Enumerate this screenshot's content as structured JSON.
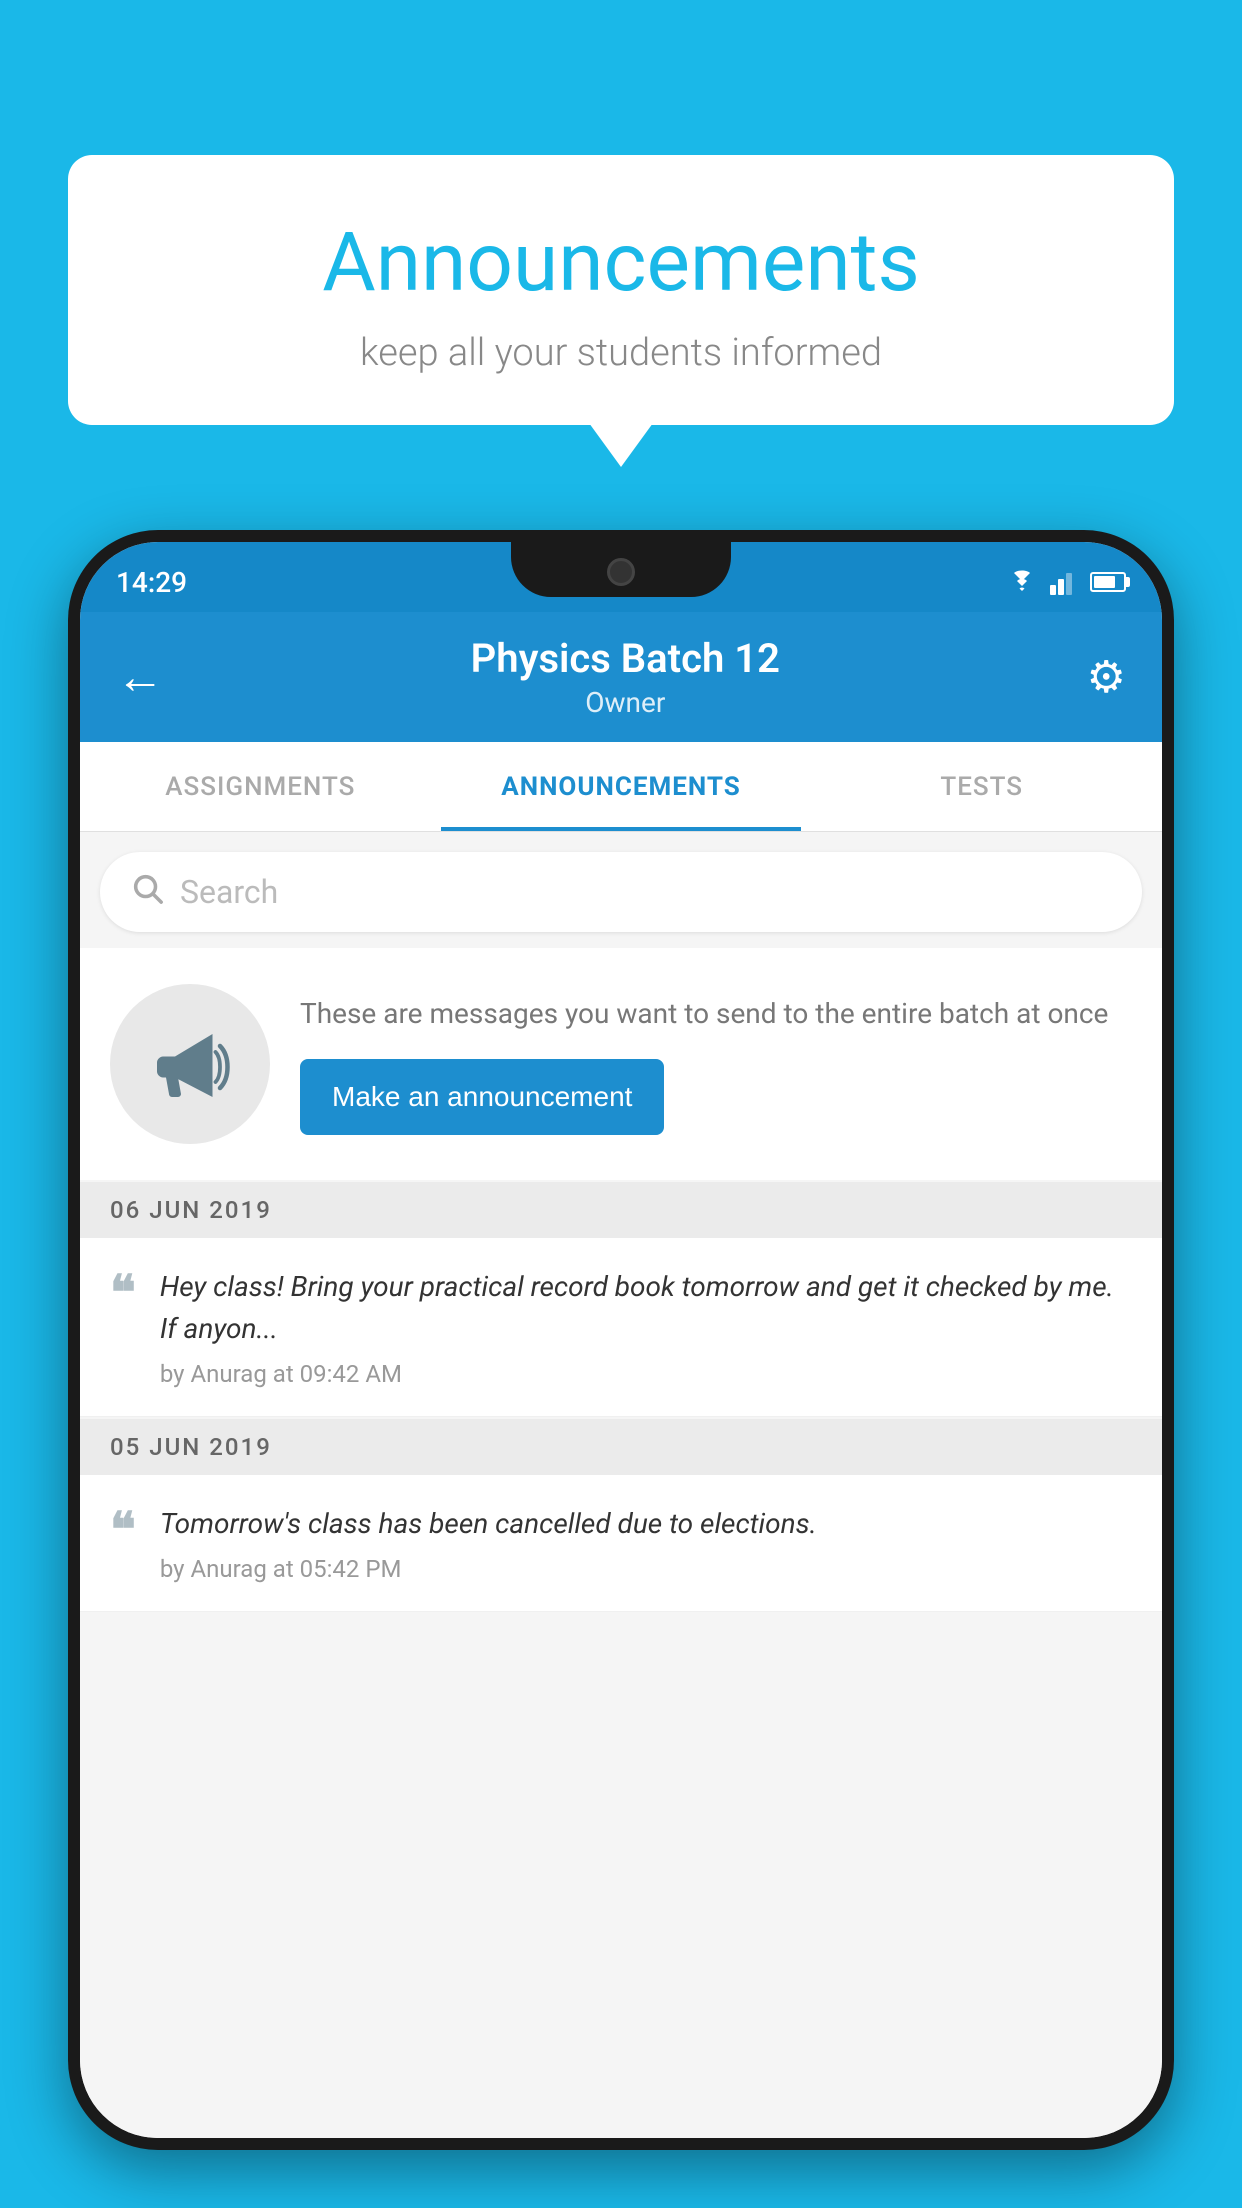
{
  "page": {
    "background_color": "#1ab8e8"
  },
  "speech_bubble": {
    "title": "Announcements",
    "subtitle": "keep all your students informed"
  },
  "phone": {
    "status_bar": {
      "time": "14:29"
    },
    "header": {
      "title": "Physics Batch 12",
      "subtitle": "Owner",
      "back_label": "←",
      "gear_label": "⚙"
    },
    "tabs": [
      {
        "label": "ASSIGNMENTS",
        "active": false
      },
      {
        "label": "ANNOUNCEMENTS",
        "active": true
      },
      {
        "label": "TESTS",
        "active": false
      }
    ],
    "search": {
      "placeholder": "Search"
    },
    "promo": {
      "description": "These are messages you want to send to the entire batch at once",
      "button_label": "Make an announcement"
    },
    "announcements": [
      {
        "date": "06  JUN  2019",
        "text": "Hey class! Bring your practical record book tomorrow and get it checked by me. If anyon...",
        "meta": "by Anurag at 09:42 AM"
      },
      {
        "date": "05  JUN  2019",
        "text": "Tomorrow's class has been cancelled due to elections.",
        "meta": "by Anurag at 05:42 PM"
      }
    ]
  }
}
